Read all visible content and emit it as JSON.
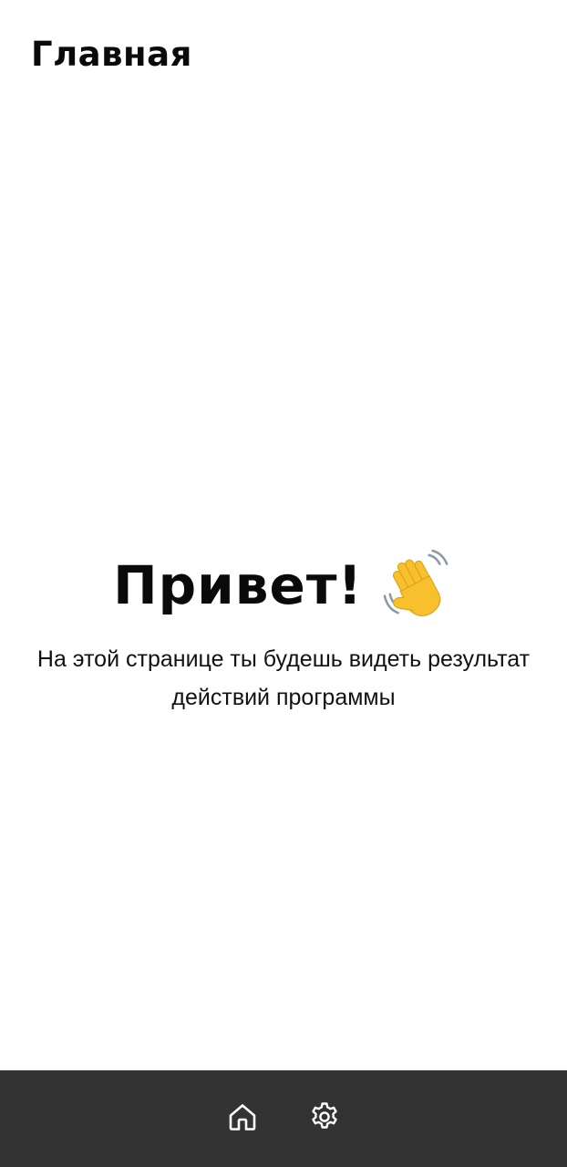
{
  "header": {
    "title": "Главная"
  },
  "greeting": {
    "title": "Привет!",
    "emoji_icon": "waving-hand-icon",
    "message": "На этой странице ты будешь видеть результат действий программы"
  },
  "bottom_nav": {
    "background": "#333333",
    "items": [
      {
        "icon": "home-icon"
      },
      {
        "icon": "gear-icon"
      }
    ]
  }
}
